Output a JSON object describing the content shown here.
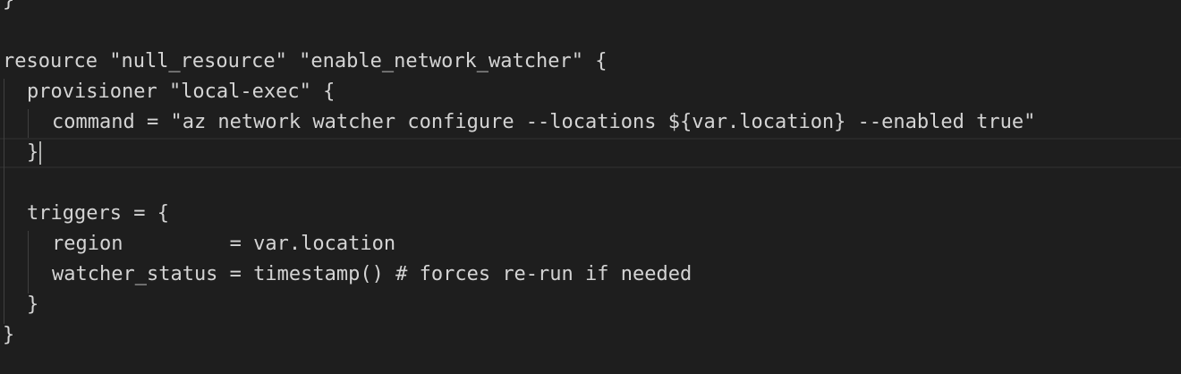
{
  "editor": {
    "lines": [
      {
        "id": "l0",
        "text": "}"
      },
      {
        "id": "l1",
        "text": ""
      },
      {
        "id": "l2",
        "text": "resource \"null_resource\" \"enable_network_watcher\" {"
      },
      {
        "id": "l3",
        "text": "provisioner \"local-exec\" {"
      },
      {
        "id": "l4",
        "text": "command = \"az network watcher configure --locations ${var.location} --enabled true\""
      },
      {
        "id": "l5",
        "text": "}"
      },
      {
        "id": "l6",
        "text": ""
      },
      {
        "id": "l7",
        "text": "triggers = {"
      },
      {
        "id": "l8",
        "text": "region         = var.location"
      },
      {
        "id": "l9",
        "text": "watcher_status = timestamp() # forces re-run if needed"
      },
      {
        "id": "l10",
        "text": "}"
      },
      {
        "id": "l11",
        "text": "}"
      }
    ]
  },
  "colors": {
    "background": "#1e1e1e",
    "text": "#d4d4d4",
    "indent_guide": "#404040",
    "current_line_border": "#282828",
    "cursor": "#aeafad"
  }
}
